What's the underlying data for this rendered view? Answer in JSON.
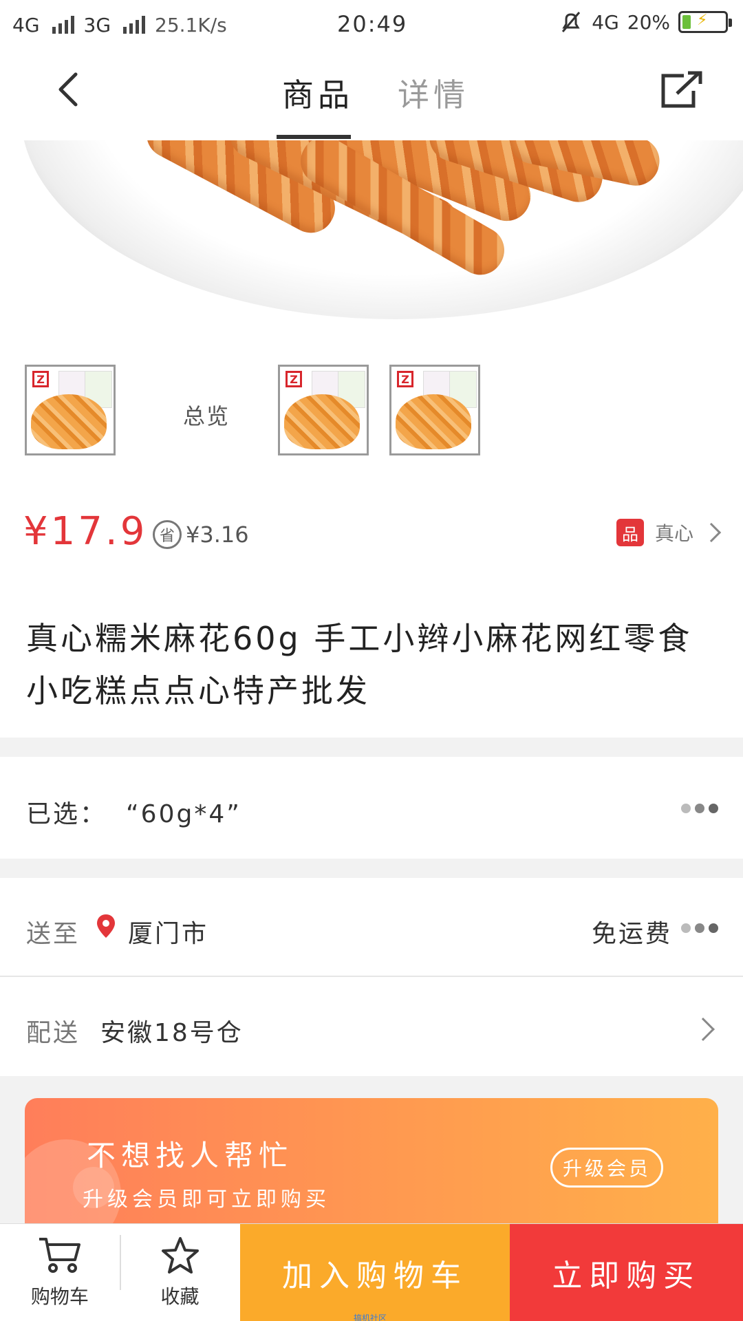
{
  "status_bar": {
    "network_left": "4G",
    "network_mid": "3G",
    "speed": "25.1K/s",
    "time": "20:49",
    "network_right": "4G",
    "battery": "20%",
    "battery_level": 0.2
  },
  "nav": {
    "tabs": [
      {
        "label": "商品",
        "active": true
      },
      {
        "label": "详情",
        "active": false
      }
    ]
  },
  "thumbnails": {
    "overview_label": "总览"
  },
  "price": {
    "current": "¥17.9",
    "save_icon_label": "省",
    "saving": "¥3.16",
    "brand_badge": "品",
    "brand_name": "真心"
  },
  "product": {
    "title": "真心糯米麻花60g 手工小辫小麻花网红零食小吃糕点点心特产批发"
  },
  "selected": {
    "label": "已选：",
    "value": "“60g*4”"
  },
  "shipping": {
    "label": "送至",
    "city": "厦门市",
    "fee": "免运费"
  },
  "delivery": {
    "label": "配送",
    "warehouse": "安徽18号仓"
  },
  "member_banner": {
    "title": "不想找人帮忙",
    "subtitle": "升级会员即可立即购买",
    "button": "升级会员"
  },
  "bottom_bar": {
    "cart": "购物车",
    "favorite": "收藏",
    "add_to_cart": "加入购物车",
    "buy_now": "立即购买",
    "watermark": "搞机社区"
  },
  "colors": {
    "price_red": "#e3363a",
    "add_to_cart": "#fbaa2a",
    "buy_now": "#f23a3a"
  }
}
